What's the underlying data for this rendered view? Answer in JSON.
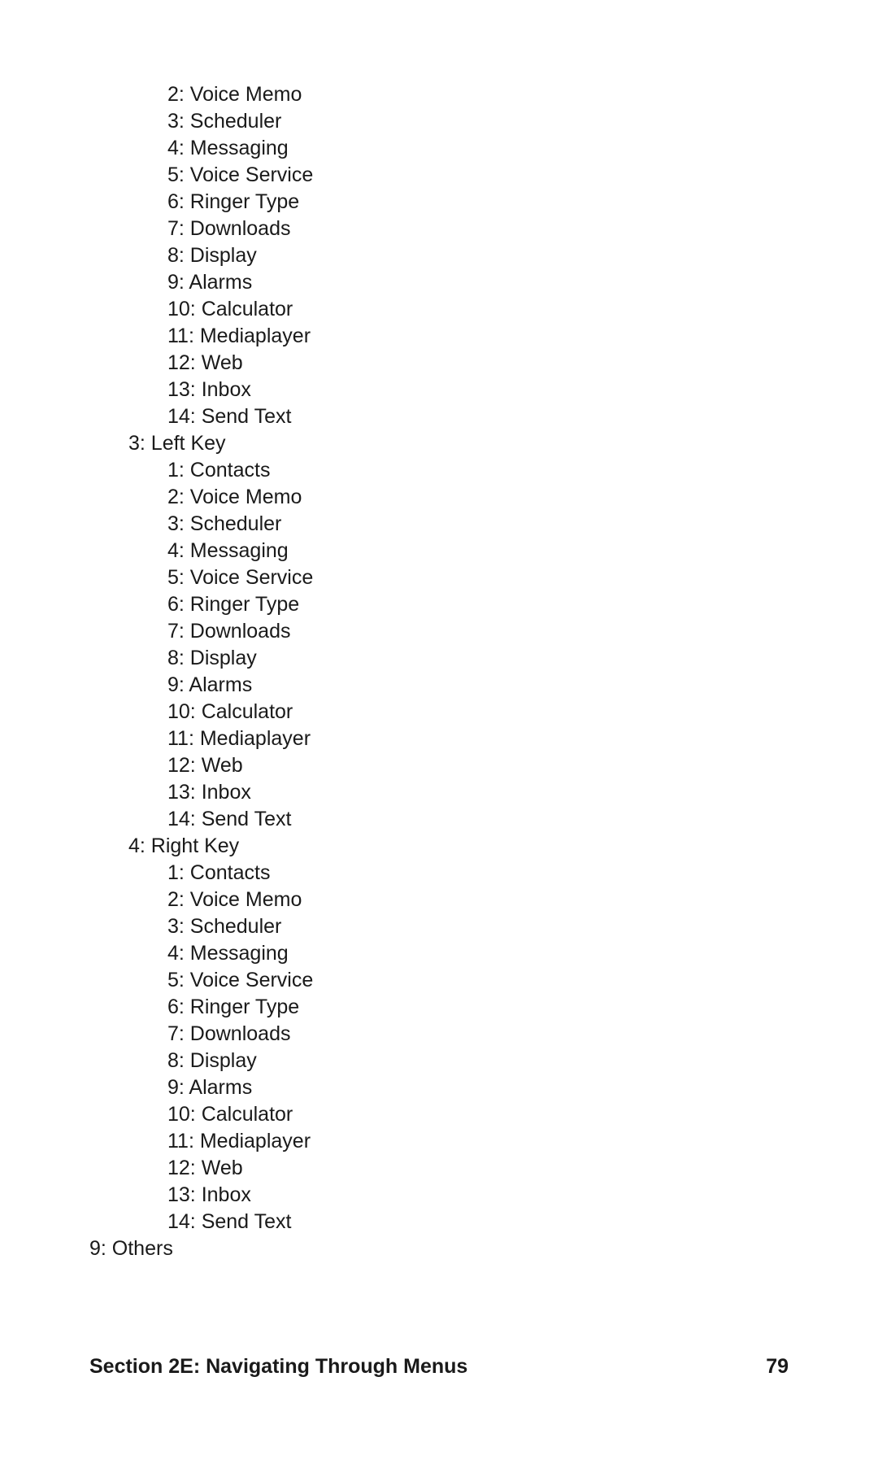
{
  "items": [
    {
      "level": 2,
      "text": "2: Voice Memo"
    },
    {
      "level": 2,
      "text": "3: Scheduler"
    },
    {
      "level": 2,
      "text": "4: Messaging"
    },
    {
      "level": 2,
      "text": "5: Voice Service"
    },
    {
      "level": 2,
      "text": "6: Ringer Type"
    },
    {
      "level": 2,
      "text": "7: Downloads"
    },
    {
      "level": 2,
      "text": "8: Display"
    },
    {
      "level": 2,
      "text": "9: Alarms"
    },
    {
      "level": 2,
      "text": "10: Calculator"
    },
    {
      "level": 2,
      "text": "11: Mediaplayer"
    },
    {
      "level": 2,
      "text": "12: Web"
    },
    {
      "level": 2,
      "text": "13: Inbox"
    },
    {
      "level": 2,
      "text": "14: Send Text"
    },
    {
      "level": 1,
      "text": "3: Left Key"
    },
    {
      "level": 2,
      "text": "1: Contacts"
    },
    {
      "level": 2,
      "text": "2: Voice Memo"
    },
    {
      "level": 2,
      "text": "3: Scheduler"
    },
    {
      "level": 2,
      "text": "4: Messaging"
    },
    {
      "level": 2,
      "text": "5: Voice Service"
    },
    {
      "level": 2,
      "text": "6: Ringer Type"
    },
    {
      "level": 2,
      "text": "7: Downloads"
    },
    {
      "level": 2,
      "text": "8: Display"
    },
    {
      "level": 2,
      "text": "9: Alarms"
    },
    {
      "level": 2,
      "text": "10: Calculator"
    },
    {
      "level": 2,
      "text": "11: Mediaplayer"
    },
    {
      "level": 2,
      "text": "12: Web"
    },
    {
      "level": 2,
      "text": "13: Inbox"
    },
    {
      "level": 2,
      "text": "14: Send Text"
    },
    {
      "level": 1,
      "text": "4: Right Key"
    },
    {
      "level": 2,
      "text": "1: Contacts"
    },
    {
      "level": 2,
      "text": "2: Voice Memo"
    },
    {
      "level": 2,
      "text": "3: Scheduler"
    },
    {
      "level": 2,
      "text": "4: Messaging"
    },
    {
      "level": 2,
      "text": "5: Voice Service"
    },
    {
      "level": 2,
      "text": "6: Ringer Type"
    },
    {
      "level": 2,
      "text": "7: Downloads"
    },
    {
      "level": 2,
      "text": "8: Display"
    },
    {
      "level": 2,
      "text": "9: Alarms"
    },
    {
      "level": 2,
      "text": "10: Calculator"
    },
    {
      "level": 2,
      "text": "11: Mediaplayer"
    },
    {
      "level": 2,
      "text": "12: Web"
    },
    {
      "level": 2,
      "text": "13: Inbox"
    },
    {
      "level": 2,
      "text": "14: Send Text"
    },
    {
      "level": 0,
      "text": "9: Others"
    }
  ],
  "footer": {
    "title": "Section 2E: Navigating Through Menus",
    "page": "79"
  }
}
